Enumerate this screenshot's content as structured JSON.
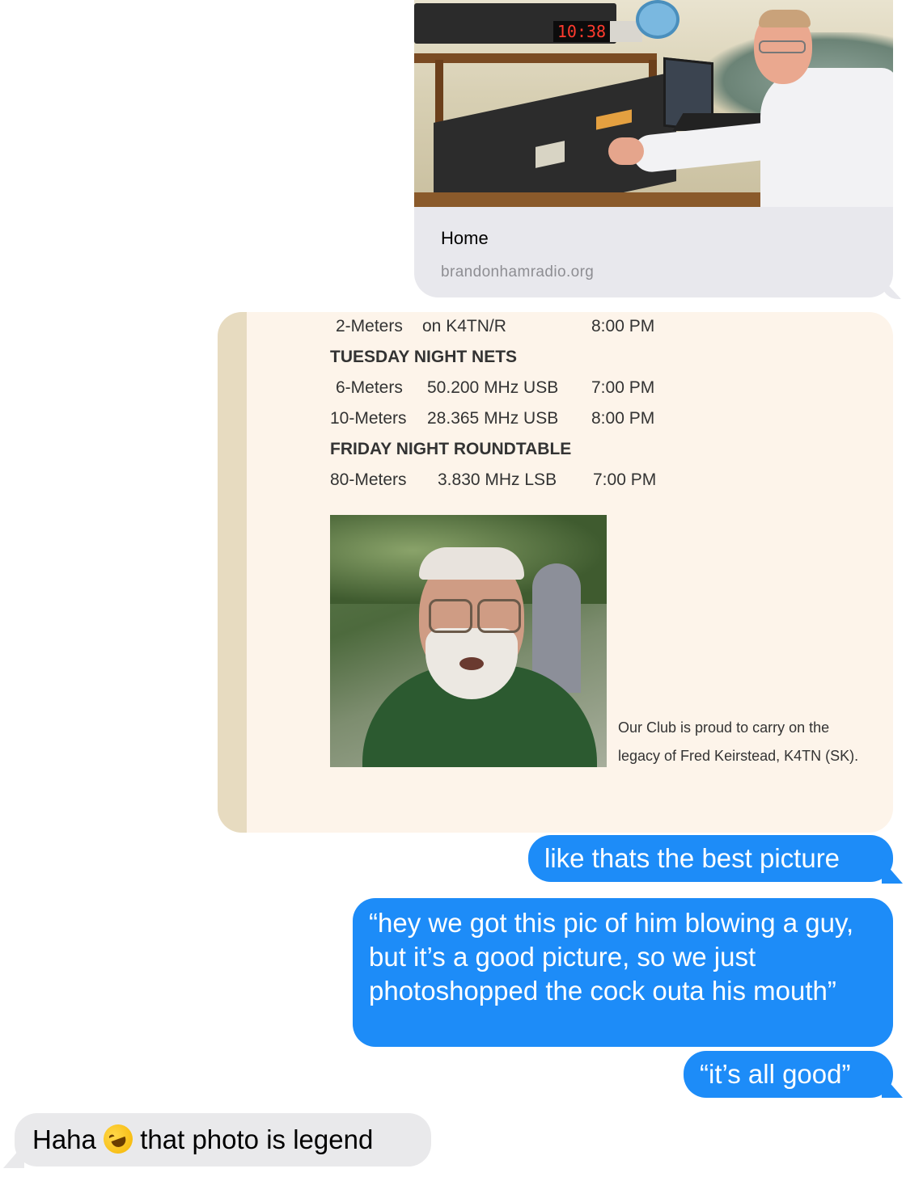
{
  "link_preview": {
    "title": "Home",
    "url": "brandonhamradio.org",
    "clock_reading": "10:38"
  },
  "screenshot": {
    "schedule": [
      {
        "band": "2-Meters",
        "detail": "on K4TN/R",
        "time": "8:00 PM"
      },
      {
        "heading": "TUESDAY NIGHT NETS"
      },
      {
        "band": "6-Meters",
        "detail": "50.200 MHz USB",
        "time": "7:00 PM"
      },
      {
        "band": "10-Meters",
        "detail": "28.365 MHz USB",
        "time": "8:00 PM"
      },
      {
        "heading": "FRIDAY NIGHT ROUNDTABLE"
      },
      {
        "band": "80-Meters",
        "detail": "3.830 MHz LSB",
        "time": "7:00 PM"
      }
    ],
    "caption_line1": "Our Club is proud to carry on the",
    "caption_line2": "legacy of Fred Keirstead, K4TN (SK)."
  },
  "messages": [
    {
      "direction": "sent",
      "text": "like thats the best picture"
    },
    {
      "direction": "sent",
      "text": "“hey we got this pic of him blowing a guy, but it’s a good picture, so we just photoshopped the cock outa his mouth”"
    },
    {
      "direction": "sent",
      "text": "“it’s all good”"
    },
    {
      "direction": "received",
      "text_before_emoji": "Haha",
      "emoji": "rolling-on-the-floor-laughing",
      "text_after_emoji": "that photo is legend"
    }
  ],
  "colors": {
    "sent_bubble": "#1d8cf8",
    "received_bubble": "#e9e9eb",
    "link_card": "#e8e8ed",
    "screenshot_bg": "#fdf4ea",
    "screenshot_stripe": "#e7dbc0"
  }
}
